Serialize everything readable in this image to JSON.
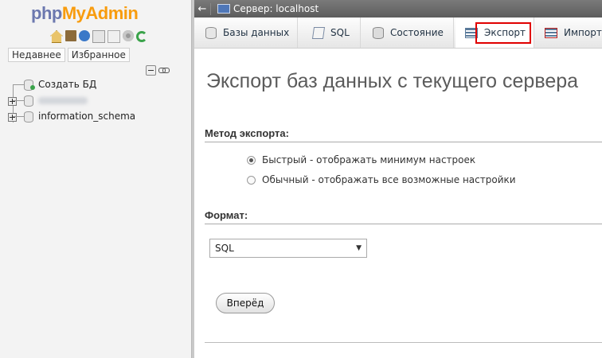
{
  "nav": {
    "logo_php": "php",
    "logo_myadmin": "MyAdmin",
    "icons": [
      "home-icon",
      "exit-icon",
      "help-icon",
      "docs-icon",
      "docs-icon",
      "settings-icon",
      "reload-icon"
    ],
    "tabs": [
      "Недавнее",
      "Избранное"
    ],
    "tree": {
      "new_db": "Создать БД",
      "databases": [
        "",
        "information_schema"
      ]
    }
  },
  "topbar": {
    "server_crumb": "Сервер: localhost"
  },
  "menu": {
    "tabs": [
      {
        "label": "Базы данных",
        "icon": "database-icon"
      },
      {
        "label": "SQL",
        "icon": "sql-icon"
      },
      {
        "label": "Состояние",
        "icon": "status-icon"
      },
      {
        "label": "Экспорт",
        "icon": "export-icon",
        "active": true
      },
      {
        "label": "Импорт",
        "icon": "import-icon"
      }
    ],
    "highlight_color": "#e00000"
  },
  "main": {
    "title": "Экспорт баз данных с текущего сервера",
    "method_heading": "Метод экспорта:",
    "method_options": [
      {
        "label": "Быстрый - отображать минимум настроек",
        "checked": true
      },
      {
        "label": "Обычный - отображать все возможные настройки",
        "checked": false
      }
    ],
    "format_heading": "Формат:",
    "format_selected": "SQL",
    "go_button": "Вперёд"
  }
}
